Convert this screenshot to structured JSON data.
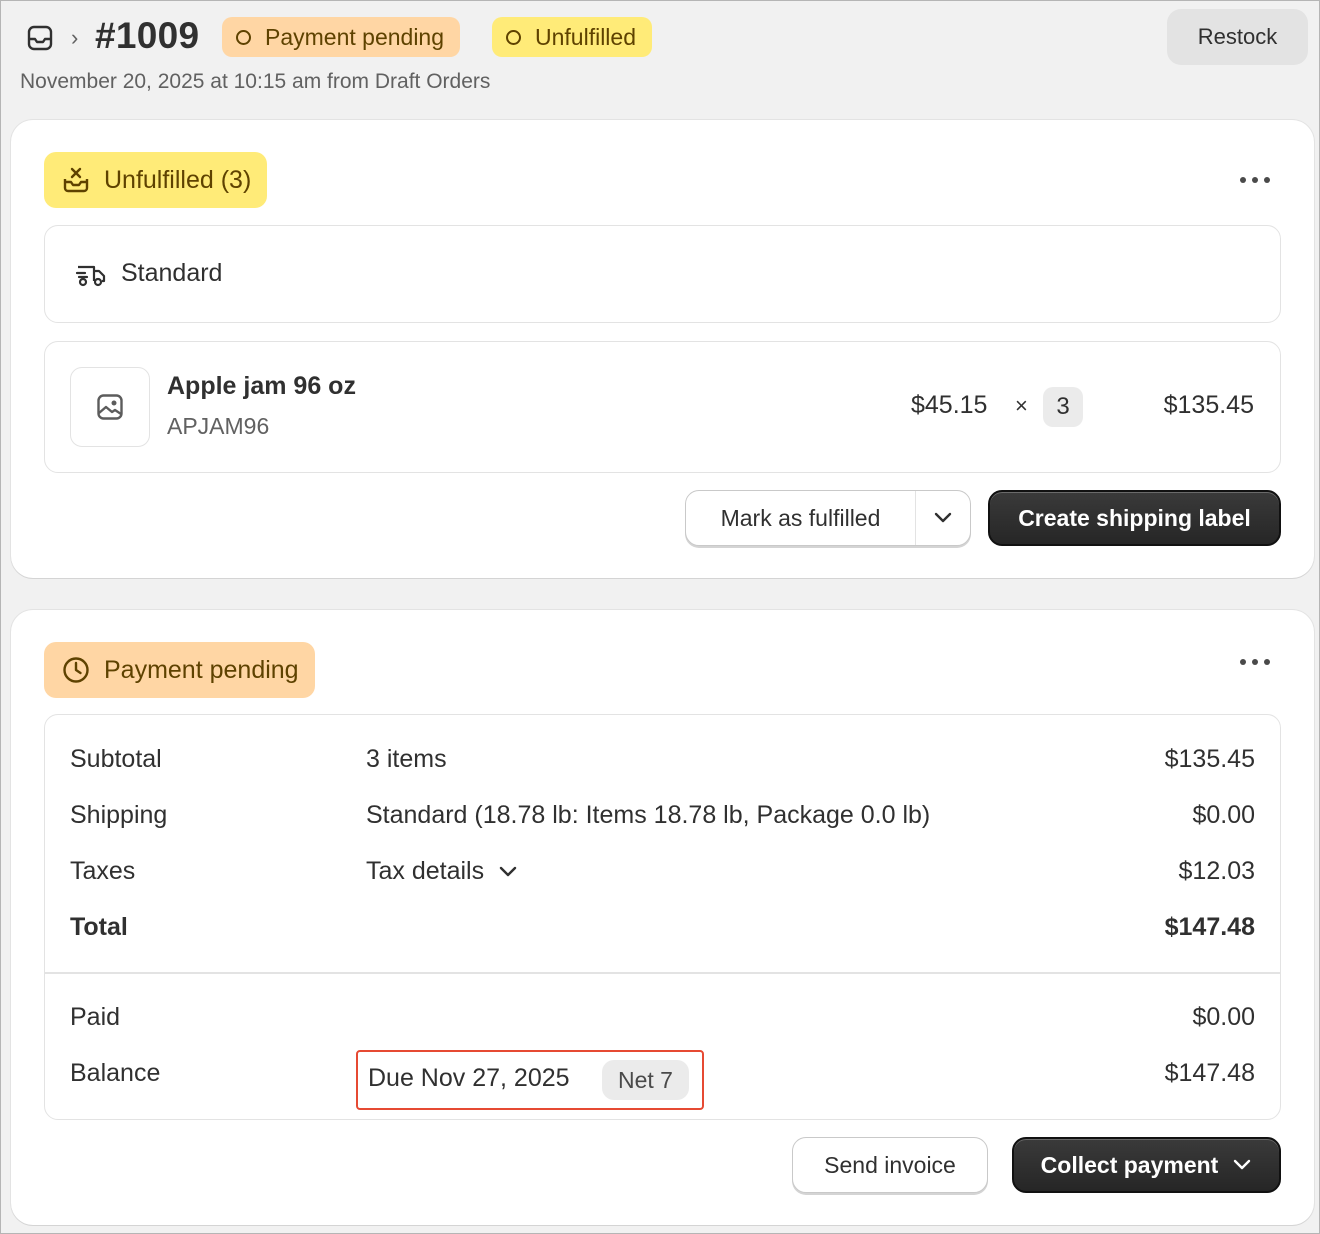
{
  "header": {
    "order_number": "#1009",
    "badges": {
      "payment": "Payment pending",
      "fulfillment": "Unfulfilled"
    },
    "restock_label": "Restock",
    "subline": "November 20, 2025 at 10:15 am from Draft Orders"
  },
  "fulfillment_card": {
    "status_label": "Unfulfilled (3)",
    "shipping_method": "Standard",
    "item": {
      "name": "Apple jam 96 oz",
      "sku": "APJAM96",
      "unit_price": "$45.15",
      "times": "×",
      "quantity": "3",
      "line_total": "$135.45"
    },
    "mark_fulfilled_label": "Mark as fulfilled",
    "create_label_label": "Create shipping label"
  },
  "payment_card": {
    "status_label": "Payment pending",
    "rows": {
      "subtotal": {
        "label": "Subtotal",
        "desc": "3 items",
        "amount": "$135.45"
      },
      "shipping": {
        "label": "Shipping",
        "desc": "Standard (18.78 lb: Items 18.78 lb, Package 0.0 lb)",
        "amount": "$0.00"
      },
      "taxes": {
        "label": "Taxes",
        "desc": "Tax details",
        "amount": "$12.03"
      },
      "total": {
        "label": "Total",
        "amount": "$147.48"
      },
      "paid": {
        "label": "Paid",
        "amount": "$0.00"
      },
      "balance": {
        "label": "Balance",
        "due": "Due Nov 27, 2025",
        "terms": "Net 7",
        "amount": "$147.48"
      }
    },
    "send_invoice_label": "Send invoice",
    "collect_payment_label": "Collect payment"
  },
  "colors": {
    "payment_badge": "#ffd6a4",
    "fulfillment_badge": "#ffeb78",
    "highlight_border": "#e64a33",
    "primary_button": "#303030"
  }
}
